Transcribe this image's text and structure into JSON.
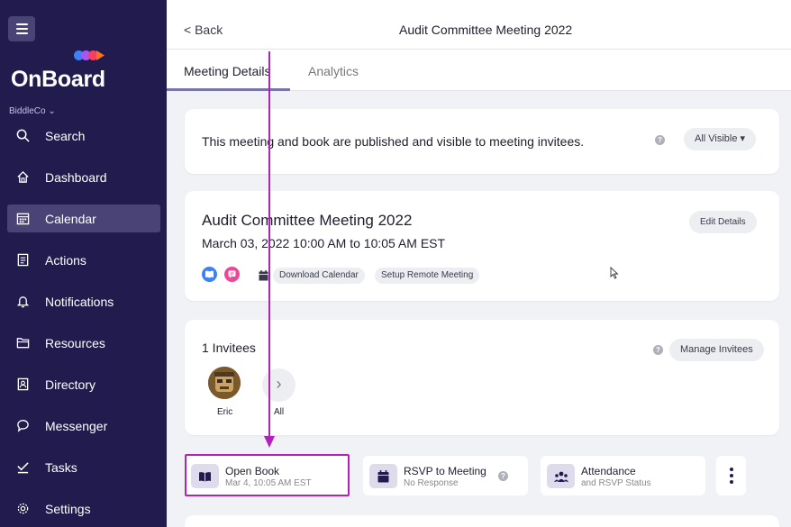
{
  "sidebar": {
    "logo_text": "OnBoard",
    "org": "BiddleCo",
    "items": [
      {
        "label": "Search",
        "icon": "search-icon",
        "active": false
      },
      {
        "label": "Dashboard",
        "icon": "home-icon",
        "active": false
      },
      {
        "label": "Calendar",
        "icon": "calendar-icon",
        "active": true
      },
      {
        "label": "Actions",
        "icon": "clipboard-icon",
        "active": false
      },
      {
        "label": "Notifications",
        "icon": "bell-icon",
        "active": false
      },
      {
        "label": "Resources",
        "icon": "folder-icon",
        "active": false
      },
      {
        "label": "Directory",
        "icon": "contact-book-icon",
        "active": false
      },
      {
        "label": "Messenger",
        "icon": "chat-bubble-icon",
        "active": false
      },
      {
        "label": "Tasks",
        "icon": "check-icon",
        "active": false
      },
      {
        "label": "Settings",
        "icon": "gear-icon",
        "active": false
      }
    ],
    "colors": {
      "background": "#221b4d",
      "active": "#4a4375"
    }
  },
  "header": {
    "back_label": "< Back",
    "title": "Audit Committee Meeting 2022"
  },
  "tabs": [
    {
      "label": "Meeting Details",
      "active": true
    },
    {
      "label": "Analytics",
      "active": false
    }
  ],
  "visibility": {
    "message": "This meeting and book are published and visible to meeting invitees.",
    "dropdown_label": "All Visible ▾"
  },
  "meeting": {
    "title": "Audit Committee Meeting 2022",
    "date_range": "March 03, 2022 10:00 AM to 10:05 AM EST",
    "edit_label": "Edit Details",
    "download_calendar": "Download Calendar",
    "setup_remote": "Setup Remote Meeting"
  },
  "invitees": {
    "count_label": "1 Invitees",
    "manage_label": "Manage Invitees",
    "people": [
      {
        "name": "Eric"
      }
    ],
    "all_label": "All"
  },
  "actions": [
    {
      "label": "Open Book",
      "sub": "Mar 4, 10:05 AM EST",
      "icon": "book-icon"
    },
    {
      "label": "RSVP to Meeting",
      "sub": "No Response",
      "icon": "calendar-icon"
    },
    {
      "label": "Attendance",
      "sub": "and RSVP Status",
      "icon": "people-icon"
    }
  ],
  "annotation_color": "#b022b8"
}
